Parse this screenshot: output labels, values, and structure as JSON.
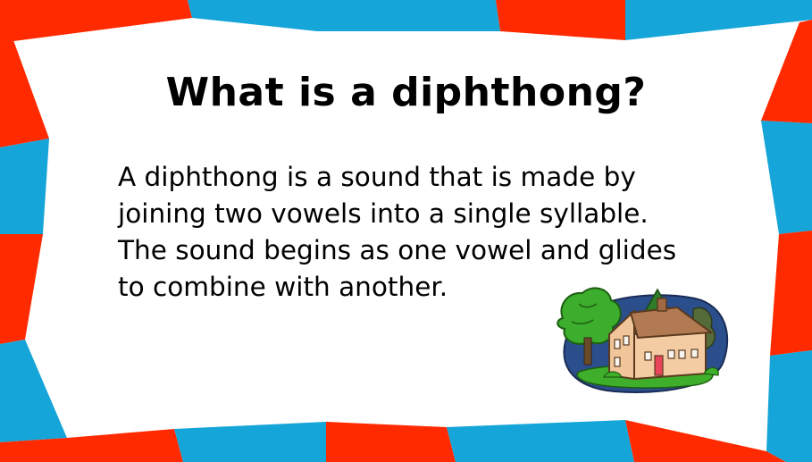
{
  "slide": {
    "title": "What is a diphthong?",
    "body_lines": [
      "A diphthong is a sound that is made by",
      "joining two vowels into a single syllable.",
      "The sound begins as one vowel and glides",
      "to combine with another."
    ]
  },
  "colors": {
    "border_red": "#ff2a00",
    "border_blue": "#15a5d8",
    "background": "#ffffff",
    "text": "#000000"
  },
  "clipart": {
    "icon": "house-with-trees-icon"
  }
}
